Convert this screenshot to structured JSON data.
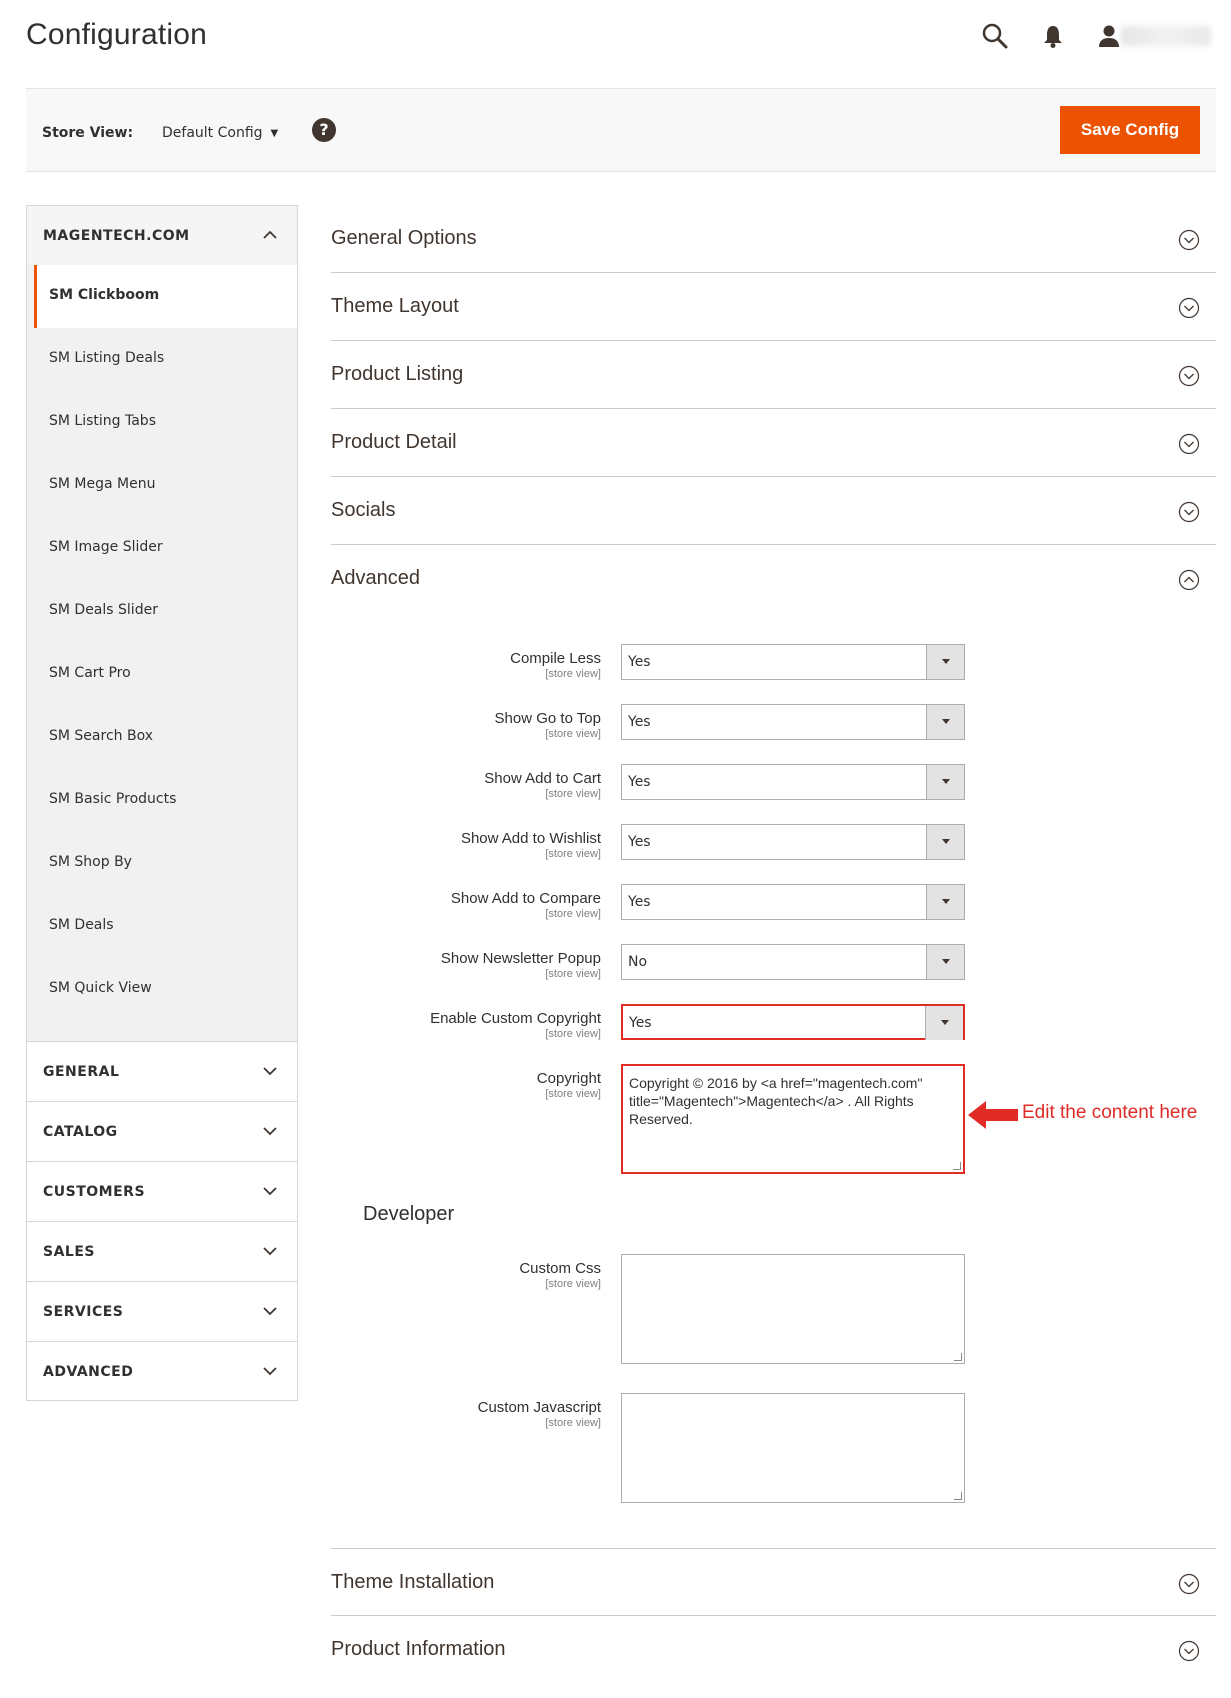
{
  "page": {
    "title": "Configuration"
  },
  "header": {
    "icons": [
      "search-icon",
      "bell-icon",
      "user-icon"
    ]
  },
  "store_bar": {
    "label": "Store View:",
    "selected": "Default Config",
    "help": "?",
    "save_label": "Save Config"
  },
  "sidebar": {
    "group_label": "MAGENTECH.COM",
    "items": [
      "SM Clickboom",
      "SM Listing Deals",
      "SM Listing Tabs",
      "SM Mega Menu",
      "SM Image Slider",
      "SM Deals Slider",
      "SM Cart Pro",
      "SM Search Box",
      "SM Basic Products",
      "SM Shop By",
      "SM Deals",
      "SM Quick View"
    ],
    "tabs": [
      "GENERAL",
      "CATALOG",
      "CUSTOMERS",
      "SALES",
      "SERVICES",
      "ADVANCED"
    ]
  },
  "sections": {
    "general_options": "General Options",
    "theme_layout": "Theme Layout",
    "product_listing": "Product Listing",
    "product_detail": "Product Detail",
    "socials": "Socials",
    "advanced": "Advanced",
    "theme_installation": "Theme Installation",
    "product_information": "Product Information"
  },
  "advanced": {
    "scope": "[store view]",
    "fields": [
      {
        "label": "Compile Less",
        "value": "Yes"
      },
      {
        "label": "Show Go to Top",
        "value": "Yes"
      },
      {
        "label": "Show Add to Cart",
        "value": "Yes"
      },
      {
        "label": "Show Add to Wishlist",
        "value": "Yes"
      },
      {
        "label": "Show Add to Compare",
        "value": "Yes"
      },
      {
        "label": "Show Newsletter Popup",
        "value": "No"
      },
      {
        "label": "Enable Custom Copyright",
        "value": "Yes"
      }
    ],
    "copyright": {
      "label": "Copyright",
      "value": "Copyright © 2016 by <a href=\"magentech.com\" title=\"Magentech\">Magentech</a> . All Rights Reserved."
    },
    "developer": {
      "title": "Developer",
      "custom_css_label": "Custom Css",
      "custom_css_value": "",
      "custom_js_label": "Custom Javascript",
      "custom_js_value": ""
    }
  },
  "annotation": {
    "text": "Edit the content here",
    "color": "#e02b27"
  },
  "colors": {
    "accent": "#eb5202",
    "highlight": "#e02b27"
  }
}
